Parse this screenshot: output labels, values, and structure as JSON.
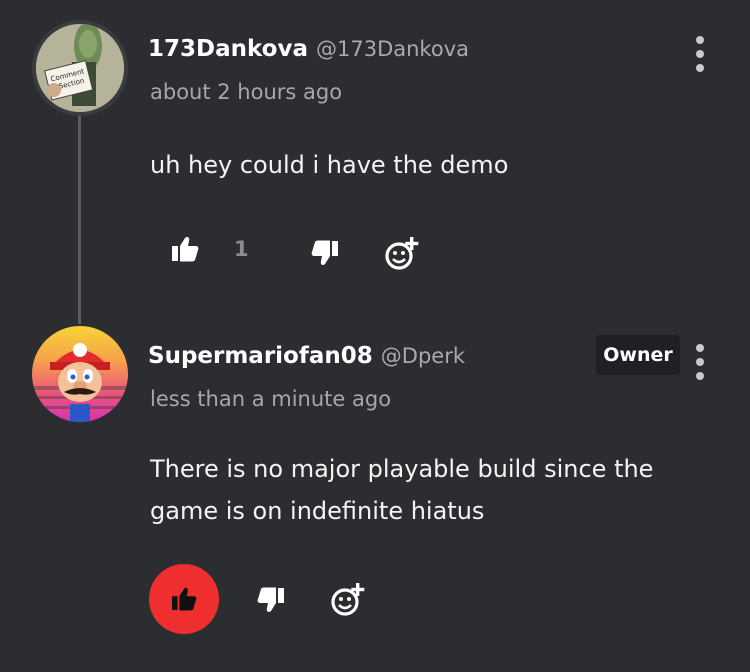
{
  "comments": [
    {
      "author": "173Dankova",
      "handle": "@173Dankova",
      "time": "about 2 hours ago",
      "text": "uh hey could i have the demo",
      "likes": "1",
      "avatar_label_top": "Comment",
      "avatar_label_bottom": "Section"
    },
    {
      "author": "Supermariofan08",
      "handle": "@Dperk",
      "badge": "Owner",
      "time": "less than a minute ago",
      "text_line1": "There is no major playable build since the",
      "text_line2": "game is on indefinite hiatus",
      "liked": true
    }
  ],
  "colors": {
    "background": "#2c2d31",
    "like_active": "#ef2f2f",
    "muted_text": "#a6a7ac"
  },
  "icons": [
    "thumbs-up-icon",
    "thumbs-down-icon",
    "add-reaction-icon",
    "more-options-icon"
  ]
}
